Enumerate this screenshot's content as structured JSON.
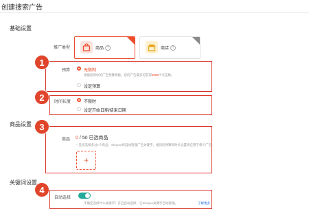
{
  "page_title": "创建搜索广告",
  "sections": {
    "basic": "基础设置",
    "product": "商品设置",
    "keyword": "关键词设置"
  },
  "ad_type": {
    "label": "推广类型",
    "options": [
      {
        "label": "商品",
        "icon": "shopping-bag-icon",
        "selected": true
      },
      {
        "label": "商店",
        "icon": "shop-icon",
        "selected": false
      }
    ]
  },
  "budget": {
    "label": "预算",
    "option_unlimited": "无限制",
    "desc_line_1": "根据您目标的广告预算余额，您的广告最多可获得",
    "desc_highlight": "8898",
    "desc_line_2": "个点击数。",
    "option_set": "设定预算"
  },
  "duration": {
    "label": "时间长度",
    "option_unlimited": "不限时",
    "option_set": "设定开始日期/结束日期"
  },
  "products": {
    "label": "商品",
    "count_current": "0",
    "count_sep": " / ",
    "count_total": "50 已选商品",
    "desc": "一旦您选择多过1个商品，Shopee将自动管理广告关键字。相同的预算和时长设置将应用于每个广告。",
    "add_symbol": "+"
  },
  "auto_select": {
    "label": "自动选择",
    "enabled": true,
    "desc": "不确定选择什么关键字？开启自动选择，让Shopee关键字自动管理。",
    "link": "了解更多"
  },
  "annotations": [
    "1",
    "2",
    "3",
    "4"
  ],
  "colors": {
    "accent": "#ee4d2d",
    "annotation_red": "#d93025",
    "toggle_green": "#26aa99"
  }
}
